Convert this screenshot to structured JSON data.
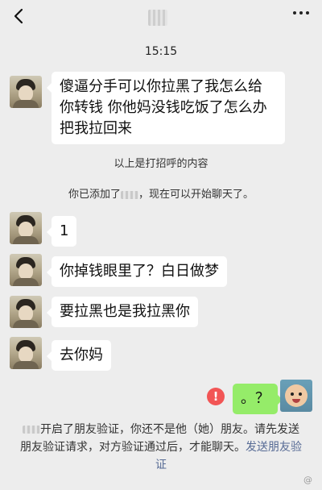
{
  "header": {
    "back_icon": "chevron-left-icon",
    "more_icon": "more-dots-icon"
  },
  "timestamp": "15:15",
  "messages": [
    {
      "side": "left",
      "text": "傻逼分手可以你拉黑了我怎么给 你转钱 你他妈没钱吃饭了怎么办 把我拉回来"
    },
    {
      "side": "left",
      "text": "1"
    },
    {
      "side": "left",
      "text": "你掉钱眼里了？白日做梦"
    },
    {
      "side": "left",
      "text": "要拉黑也是我拉黑你"
    },
    {
      "side": "left",
      "text": "去你妈"
    },
    {
      "side": "right",
      "text": "。？"
    }
  ],
  "system": {
    "greeting_note": "以上是打招呼的内容",
    "added_prefix": "你已添加了",
    "added_suffix": "，现在可以开始聊天了。"
  },
  "send_failed_icon": "!",
  "notice": {
    "text": "开启了朋友验证，你还不是他（她）朋友。请先发送朋友验证请求，对方验证通过后，才能聊天。",
    "link": "发送朋友验证"
  },
  "watermark": "@"
}
